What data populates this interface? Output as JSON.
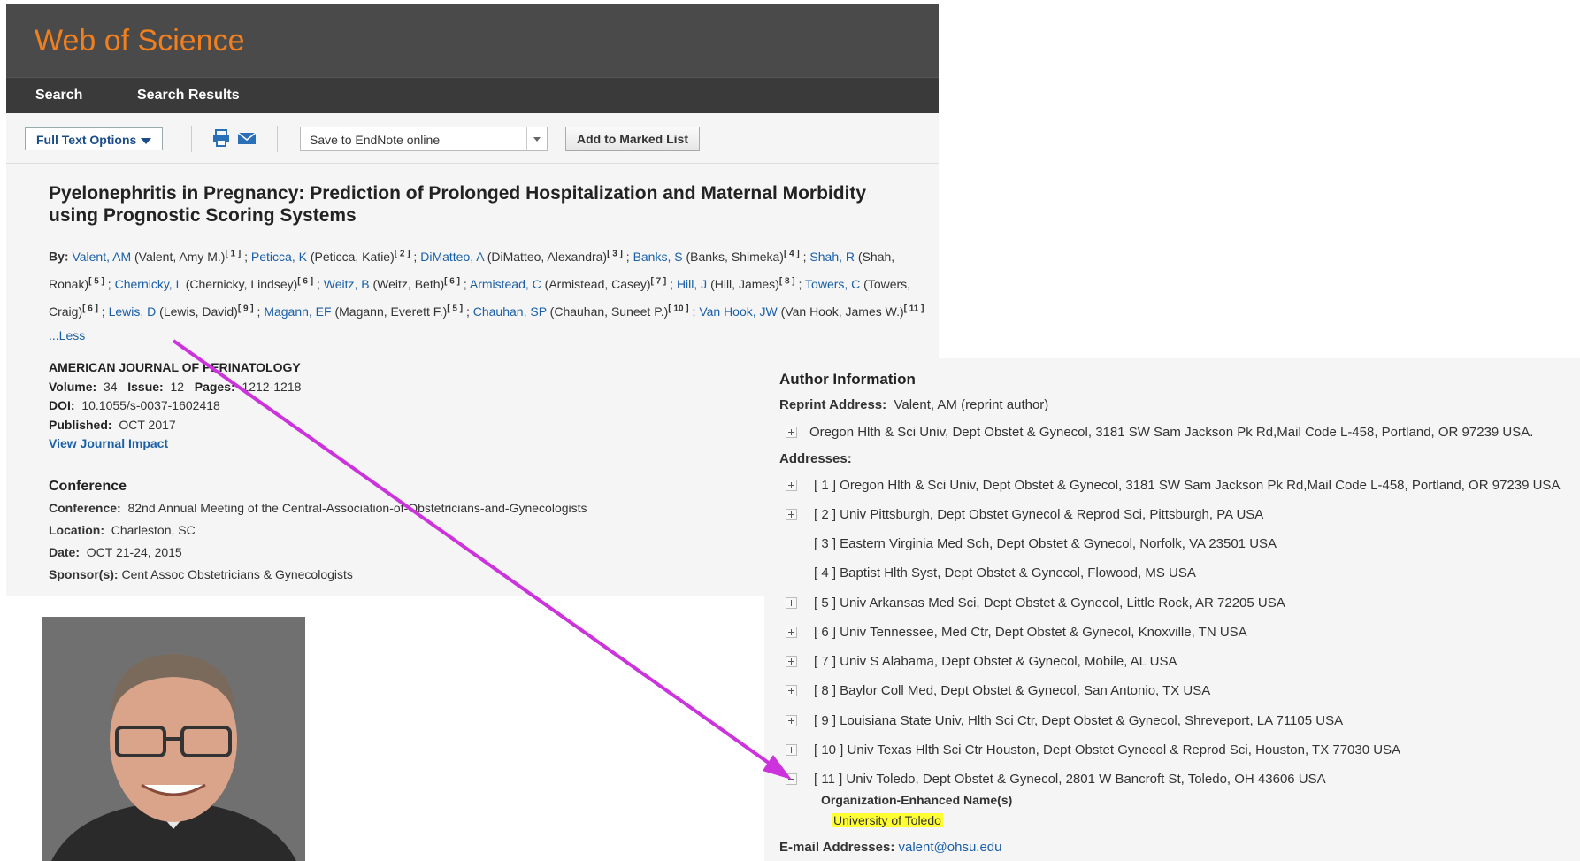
{
  "app": {
    "logo": "Web of Science",
    "nav": [
      "Search",
      "Search Results"
    ]
  },
  "toolbar": {
    "full_text": "Full Text Options",
    "save_to": "Save to EndNote online",
    "add_marked": "Add to Marked List"
  },
  "record": {
    "title": "Pyelonephritis in Pregnancy: Prediction of Prolonged Hospitalization and Maternal Morbidity using Prognostic Scoring Systems",
    "by_label": "By:",
    "authors": [
      {
        "short": "Valent, AM",
        "full": "(Valent, Amy M.)",
        "ref": "[ 1 ]"
      },
      {
        "short": "Peticca, K",
        "full": "(Peticca, Katie)",
        "ref": "[ 2 ]"
      },
      {
        "short": "DiMatteo, A",
        "full": "(DiMatteo, Alexandra)",
        "ref": "[ 3 ]"
      },
      {
        "short": "Banks, S",
        "full": "(Banks, Shimeka)",
        "ref": "[ 4 ]"
      },
      {
        "short": "Shah, R",
        "full": "(Shah, Ronak)",
        "ref": "[ 5 ]"
      },
      {
        "short": "Chernicky, L",
        "full": "(Chernicky, Lindsey)",
        "ref": "[ 6 ]"
      },
      {
        "short": "Weitz, B",
        "full": "(Weitz, Beth)",
        "ref": "[ 6 ]"
      },
      {
        "short": "Armistead, C",
        "full": "(Armistead, Casey)",
        "ref": "[ 7 ]"
      },
      {
        "short": "Hill, J",
        "full": "(Hill, James)",
        "ref": "[ 8 ]"
      },
      {
        "short": "Towers, C",
        "full": "(Towers, Craig)",
        "ref": "[ 6 ]"
      },
      {
        "short": "Lewis, D",
        "full": "(Lewis, David)",
        "ref": "[ 9 ]"
      },
      {
        "short": "Magann, EF",
        "full": "(Magann, Everett F.)",
        "ref": "[ 5 ]"
      },
      {
        "short": "Chauhan, SP",
        "full": "(Chauhan, Suneet P.)",
        "ref": "[ 10 ]"
      },
      {
        "short": "Van Hook, JW",
        "full": "(Van Hook, James W.)",
        "ref": "[ 11 ]"
      }
    ],
    "less": "...Less",
    "journal": "AMERICAN JOURNAL OF PERINATOLOGY",
    "volume_label": "Volume:",
    "volume": "34",
    "issue_label": "Issue:",
    "issue": "12",
    "pages_label": "Pages:",
    "pages": "1212-1218",
    "doi_label": "DOI:",
    "doi": "10.1055/s-0037-1602418",
    "published_label": "Published:",
    "published": "OCT 2017",
    "view_impact": "View Journal Impact",
    "conference_heading": "Conference",
    "conference_label": "Conference:",
    "conference": "82nd Annual Meeting of the Central-Association-of-Obstetricians-and-Gynecologists",
    "location_label": "Location:",
    "location": "Charleston, SC",
    "date_label": "Date:",
    "date": "OCT 21-24, 2015",
    "sponsor_label": "Sponsor(s):",
    "sponsor": "Cent Assoc Obstetricians & Gynecologists"
  },
  "author_info": {
    "heading": "Author Information",
    "reprint_label": "Reprint Address:",
    "reprint_value": "Valent, AM (reprint author)",
    "reprint_address": "Oregon Hlth & Sci Univ, Dept Obstet & Gynecol, 3181 SW Sam Jackson Pk Rd,Mail Code L-458, Portland, OR 97239 USA.",
    "addresses_label": "Addresses:",
    "addresses": [
      "[ 1 ] Oregon Hlth & Sci Univ, Dept Obstet & Gynecol, 3181 SW Sam Jackson Pk Rd,Mail Code L-458, Portland, OR 97239 USA",
      "[ 2 ] Univ Pittsburgh, Dept Obstet Gynecol & Reprod Sci, Pittsburgh, PA USA",
      "[ 3 ] Eastern Virginia Med Sch, Dept Obstet & Gynecol, Norfolk, VA 23501 USA",
      "[ 4 ] Baptist Hlth Syst, Dept Obstet & Gynecol, Flowood, MS USA",
      "[ 5 ] Univ Arkansas Med Sci, Dept Obstet & Gynecol, Little Rock, AR 72205 USA",
      "[ 6 ] Univ Tennessee, Med Ctr, Dept Obstet & Gynecol, Knoxville, TN USA",
      "[ 7 ] Univ S Alabama, Dept Obstet & Gynecol, Mobile, AL USA",
      "[ 8 ] Baylor Coll Med, Dept Obstet & Gynecol, San Antonio, TX USA",
      "[ 9 ] Louisiana State Univ, Hlth Sci Ctr, Dept Obstet & Gynecol, Shreveport, LA 71105 USA",
      "[ 10 ] Univ Texas Hlth Sci Ctr Houston, Dept Obstet Gynecol & Reprod Sci, Houston, TX 77030 USA",
      "[ 11 ] Univ Toledo, Dept Obstet & Gynecol, 2801 W Bancroft St, Toledo, OH 43606 USA"
    ],
    "org_label": "Organization-Enhanced Name(s)",
    "org_value": "University of Toledo",
    "email_label": "E-mail Addresses:",
    "email": "valent@ohsu.edu"
  },
  "colors": {
    "accent_arrow": "#cc33dd",
    "logo": "#f07f1f",
    "highlight": "#ffff33",
    "link": "#1a5fa8"
  }
}
